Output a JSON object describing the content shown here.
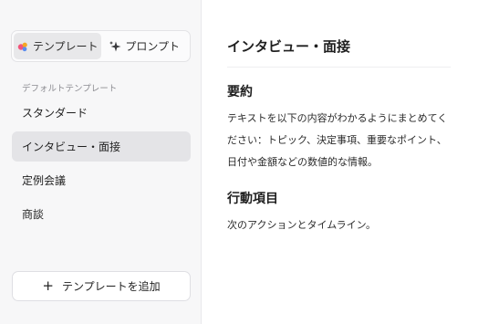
{
  "sidebar": {
    "tabs": [
      {
        "label": "テンプレート",
        "icon": "template-icon",
        "active": true
      },
      {
        "label": "プロンプト",
        "icon": "sparkle-icon",
        "active": false
      }
    ],
    "section_label": "デフォルトテンプレート",
    "items": [
      {
        "label": "スタンダード",
        "active": false
      },
      {
        "label": "インタビュー・面接",
        "active": true
      },
      {
        "label": "定例会議",
        "active": false
      },
      {
        "label": "商談",
        "active": false
      }
    ],
    "add_button": {
      "label": "テンプレートを追加",
      "icon": "plus-icon"
    }
  },
  "main": {
    "title": "インタビュー・面接",
    "sections": [
      {
        "heading": "要約",
        "body": "テキストを以下の内容がわかるようにまとめてください：トピック、決定事項、重要なポイント、日付や金額などの数値的な情報。"
      },
      {
        "heading": "行動項目",
        "body": "次のアクションとタイムライン。"
      }
    ]
  },
  "colors": {
    "sidebar_bg": "#f7f7f8",
    "active_item_bg": "#e4e4e7",
    "template_icon_colors": [
      "#f2547a",
      "#f5a623",
      "#5b8def"
    ],
    "text": "#1f1f1f"
  }
}
